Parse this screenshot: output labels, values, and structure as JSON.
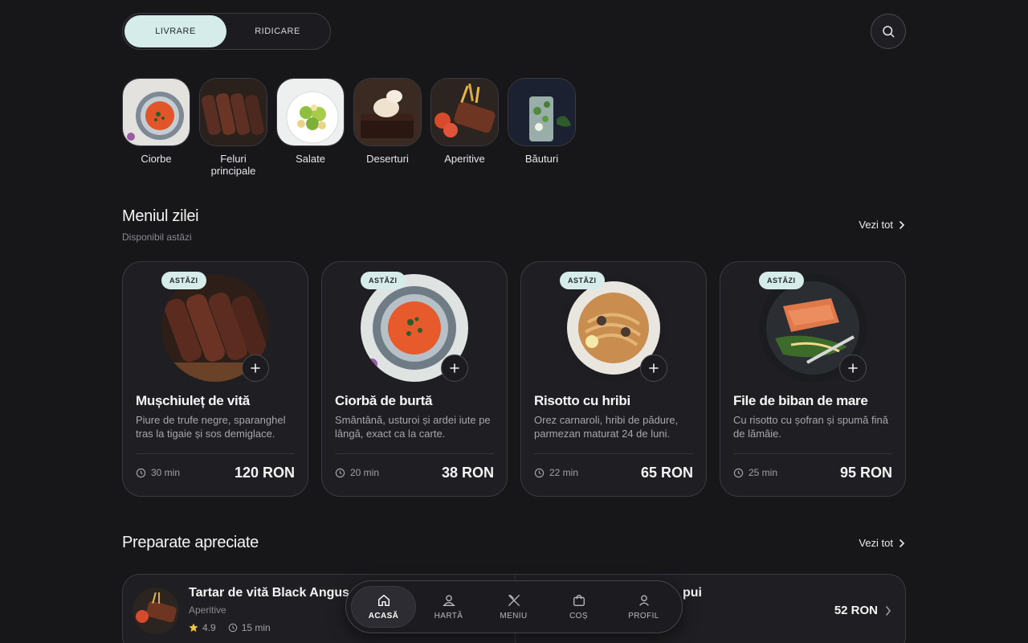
{
  "toggle": {
    "delivery": "LIVRARE",
    "pickup": "RIDICARE"
  },
  "categories": [
    {
      "label": "Ciorbe",
      "image": "soup-bowl"
    },
    {
      "label": "Feluri principale",
      "image": "sliced-steak"
    },
    {
      "label": "Salate",
      "image": "salad-plate"
    },
    {
      "label": "Deserturi",
      "image": "brownie-dessert"
    },
    {
      "label": "Aperitive",
      "image": "ribs-fries-platter"
    },
    {
      "label": "Băuturi",
      "image": "mojito-glass"
    }
  ],
  "daily": {
    "title": "Meniul zilei",
    "subtitle": "Disponibil astăzi",
    "see_all": "Vezi tot",
    "cards": [
      {
        "badge": "ASTĂZI",
        "name": "Mușchiuleț de vită",
        "desc": "Piure de trufe negre, sparanghel tras la tigaie și sos demiglace.",
        "time": "30 min",
        "price": "120 RON"
      },
      {
        "badge": "ASTĂZI",
        "name": "Ciorbă de burtă",
        "desc": "Smântână, usturoi și ardei iute pe lângă, exact ca la carte.",
        "time": "20 min",
        "price": "38 RON"
      },
      {
        "badge": "ASTĂZI",
        "name": "Risotto cu hribi",
        "desc": "Orez carnaroli, hribi de pădure, parmezan maturat 24 de luni.",
        "time": "22 min",
        "price": "65 RON"
      },
      {
        "badge": "ASTĂZI",
        "name": "File de biban de mare",
        "desc": "Cu risotto cu șofran și spumă fină de lămâie.",
        "time": "25 min",
        "price": "95 RON"
      }
    ]
  },
  "popular": {
    "title": "Preparate apreciate",
    "see_all": "Vezi tot",
    "item1": {
      "name": "Tartar de vită Black Angus",
      "category": "Aperitive",
      "rating": "4.9",
      "time": "15 min"
    },
    "item2": {
      "name_fragment": "pui",
      "price": "52 RON"
    }
  },
  "nav": [
    {
      "label": "ACASĂ",
      "icon": "home-icon",
      "active": true
    },
    {
      "label": "HARTĂ",
      "icon": "map-pin-icon",
      "active": false
    },
    {
      "label": "MENIU",
      "icon": "utensils-icon",
      "active": false
    },
    {
      "label": "COȘ",
      "icon": "bag-icon",
      "active": false
    },
    {
      "label": "PROFIL",
      "icon": "user-icon",
      "active": false
    }
  ],
  "colors": {
    "background": "#17171a",
    "accent": "#d6ecea",
    "card": "#1f1f23"
  }
}
